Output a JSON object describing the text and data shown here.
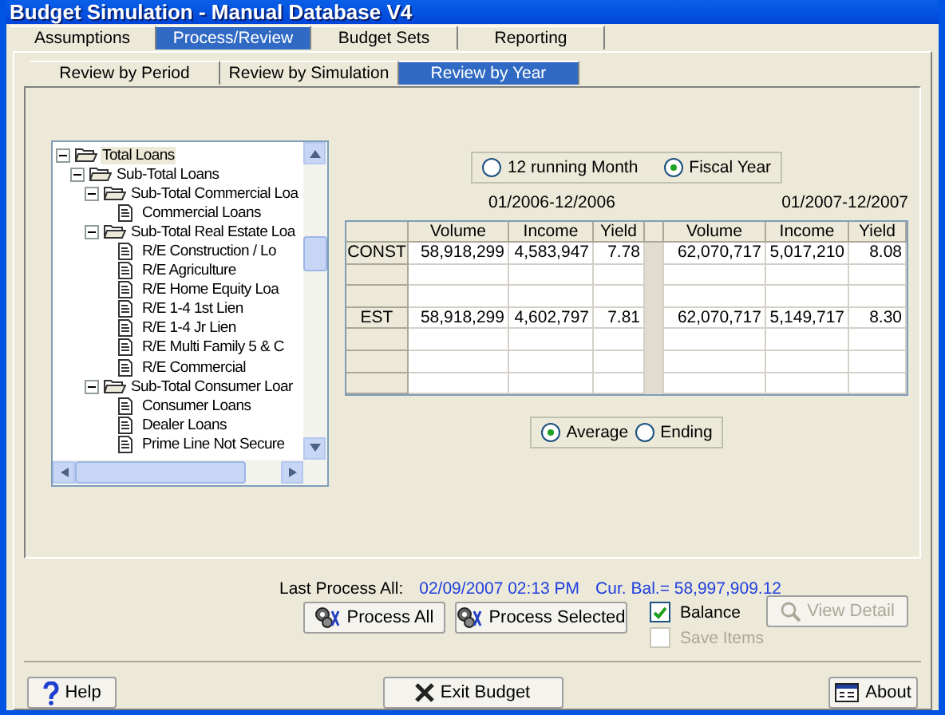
{
  "window": {
    "title": "Budget Simulation - Manual Database V4"
  },
  "tabs": [
    {
      "label": "Assumptions",
      "selected": false
    },
    {
      "label": "Process/Review",
      "selected": true
    },
    {
      "label": "Budget Sets",
      "selected": false
    },
    {
      "label": "Reporting",
      "selected": false
    }
  ],
  "sub_tabs": [
    {
      "label": "Review by Period",
      "selected": false
    },
    {
      "label": "Review by Simulation",
      "selected": false
    },
    {
      "label": "Review by Year",
      "selected": true
    }
  ],
  "tree": [
    {
      "kind": "folder",
      "label": "Total Loans",
      "expanded": true,
      "selected": true,
      "children": [
        {
          "kind": "folder",
          "label": "Sub-Total Loans",
          "expanded": true,
          "selected": false,
          "children": [
            {
              "kind": "folder",
              "label": "Sub-Total Commercial Loa",
              "expanded": true,
              "selected": false,
              "children": [
                {
                  "kind": "document",
                  "label": "Commercial Loans",
                  "selected": false
                }
              ]
            },
            {
              "kind": "folder",
              "label": "Sub-Total Real Estate Loa",
              "expanded": true,
              "selected": false,
              "children": [
                {
                  "kind": "document",
                  "label": "R/E Construction / Lo",
                  "selected": false
                },
                {
                  "kind": "document",
                  "label": "R/E Agriculture",
                  "selected": false
                },
                {
                  "kind": "document",
                  "label": "R/E Home Equity Loa",
                  "selected": false
                },
                {
                  "kind": "document",
                  "label": "R/E 1-4 1st Lien",
                  "selected": false
                },
                {
                  "kind": "document",
                  "label": "R/E 1-4 Jr Lien",
                  "selected": false
                },
                {
                  "kind": "document",
                  "label": "R/E Multi Family 5 & C",
                  "selected": false
                },
                {
                  "kind": "document",
                  "label": "R/E Commercial",
                  "selected": false
                }
              ]
            },
            {
              "kind": "folder",
              "label": "Sub-Total Consumer Loar",
              "expanded": true,
              "selected": false,
              "children": [
                {
                  "kind": "document",
                  "label": "Consumer Loans",
                  "selected": false
                },
                {
                  "kind": "document",
                  "label": "Dealer Loans",
                  "selected": false
                },
                {
                  "kind": "document",
                  "label": "Prime Line Not Secure",
                  "selected": false
                }
              ]
            }
          ]
        }
      ]
    }
  ],
  "period_options": [
    {
      "label": "12 running Month",
      "selected": false
    },
    {
      "label": "Fiscal Year",
      "selected": true
    }
  ],
  "period_headings": [
    "01/2006-12/2006",
    "01/2007-12/2007"
  ],
  "table": {
    "columns": [
      "Volume",
      "Income",
      "Yield",
      "Volume",
      "Income",
      "Yield"
    ],
    "rows": [
      {
        "kind": "data",
        "label": "CONST",
        "cells": [
          "58,918,299",
          "4,583,947",
          "7.78",
          "62,070,717",
          "5,017,210",
          "8.08"
        ]
      },
      {
        "kind": "empty"
      },
      {
        "kind": "empty"
      },
      {
        "kind": "data",
        "label": "EST",
        "cells": [
          "58,918,299",
          "4,602,797",
          "7.81",
          "62,070,717",
          "5,149,717",
          "8.30"
        ]
      },
      {
        "kind": "empty"
      },
      {
        "kind": "empty"
      },
      {
        "kind": "empty"
      }
    ]
  },
  "value_options": [
    {
      "label": "Average",
      "selected": true
    },
    {
      "label": "Ending",
      "selected": false
    }
  ],
  "status": {
    "label": "Last Process All:",
    "date": "02/09/2007 02:13 PM",
    "balance": "Cur. Bal.= 58,997,909.12"
  },
  "process_buttons": [
    "Process All",
    "Process Selected"
  ],
  "checkboxes": [
    {
      "label": "Balance",
      "checked": true,
      "disabled": false
    },
    {
      "label": "Save Items",
      "checked": false,
      "disabled": true
    }
  ],
  "view_detail": {
    "label": "View Detail",
    "disabled": true
  },
  "footer_buttons": [
    {
      "kind": "help",
      "label": "Help"
    },
    {
      "kind": "exit",
      "label": "Exit Budget"
    },
    {
      "kind": "about",
      "label": "About"
    }
  ]
}
